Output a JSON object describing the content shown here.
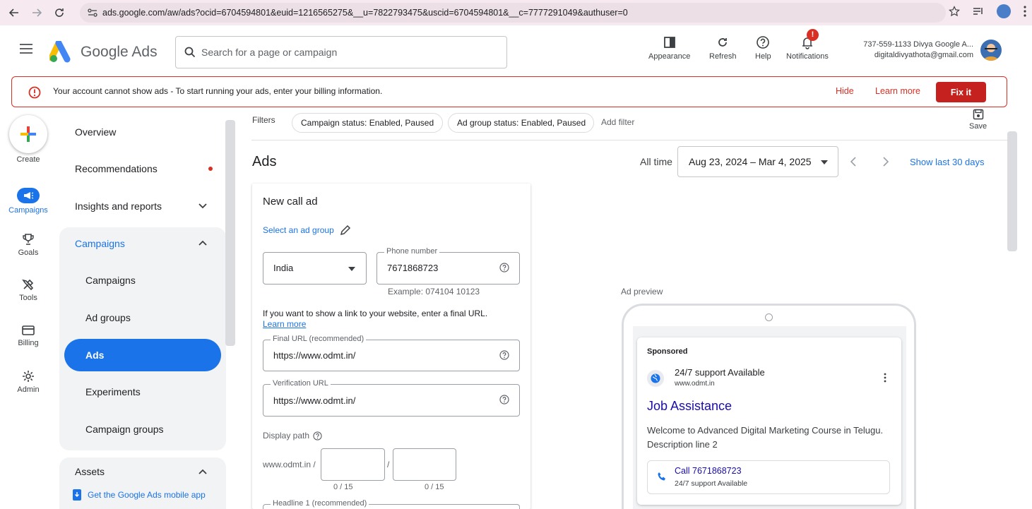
{
  "browser": {
    "url": "ads.google.com/aw/ads?ocid=6704594801&euid=1216565275&__u=7822793475&uscid=6704594801&__c=7777291049&authuser=0"
  },
  "header": {
    "app_name": "Google Ads",
    "search_placeholder": "Search for a page or campaign",
    "tools": {
      "appearance": "Appearance",
      "refresh": "Refresh",
      "help": "Help",
      "notifications": "Notifications"
    },
    "notification_badge": "!",
    "account_line1": "737-559-1133 Divya Google A...",
    "account_line2": "digitaldivyathota@gmail.com"
  },
  "alert": {
    "bold": "Your account cannot show ads",
    "message": " - To start running your ads, enter your billing information.",
    "hide": "Hide",
    "learn_more": "Learn more",
    "fix": "Fix it"
  },
  "rail": {
    "create": "Create",
    "campaigns": "Campaigns",
    "goals": "Goals",
    "tools": "Tools",
    "billing": "Billing",
    "admin": "Admin"
  },
  "nav": {
    "overview": "Overview",
    "recommendations": "Recommendations",
    "insights": "Insights and reports",
    "campaigns_group": "Campaigns",
    "campaigns": "Campaigns",
    "ad_groups": "Ad groups",
    "ads": "Ads",
    "experiments": "Experiments",
    "campaign_groups": "Campaign groups",
    "assets": "Assets",
    "mobile_app": "Get the Google Ads mobile app"
  },
  "filters": {
    "label": "Filters",
    "chip1": "Campaign status: Enabled, Paused",
    "chip2": "Ad group status: Enabled, Paused",
    "add": "Add filter",
    "save": "Save"
  },
  "page": {
    "title": "Ads",
    "range_label": "All time",
    "date_range": "Aug 23, 2024 – Mar 4, 2025",
    "show_last": "Show last 30 days"
  },
  "form": {
    "title": "New call ad",
    "select_group": "Select an ad group",
    "country": "India",
    "phone_label": "Phone number",
    "phone": "7671868723",
    "phone_example": "Example: 074104 10123",
    "final_url_hint": "If you want to show a link to your website, enter a final URL.",
    "learn_more": "Learn more",
    "final_url_label": "Final URL (recommended)",
    "final_url": "https://www.odmt.in/",
    "verification_label": "Verification URL",
    "verification_url": "https://www.odmt.in/",
    "display_path_label": "Display path",
    "display_path_base": "www.odmt.in /",
    "path_sep": "/",
    "path1_count": "0 / 15",
    "path2_count": "0 / 15",
    "headline1_label": "Headline 1 (recommended)"
  },
  "preview": {
    "label": "Ad preview",
    "sponsored": "Sponsored",
    "business": "24/7 support Available",
    "domain": "www.odmt.in",
    "headline": "Job Assistance",
    "description": "Welcome to Advanced Digital Marketing Course in Telugu. Description line 2",
    "call_text": "Call 7671868723",
    "call_sub": "24/7 support Available"
  },
  "colors": {
    "accent": "#1a73e8",
    "error": "#d93025",
    "fix_button": "#c5221f"
  }
}
